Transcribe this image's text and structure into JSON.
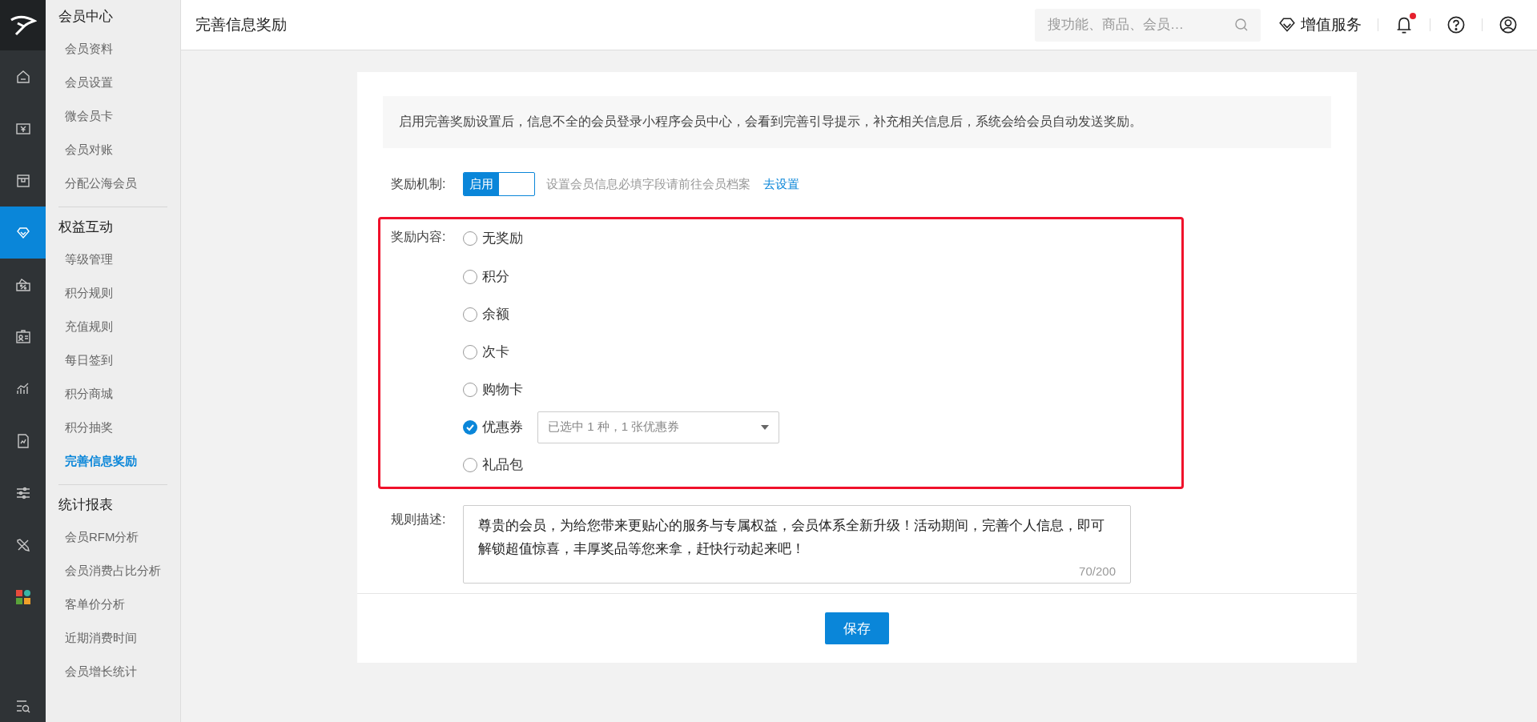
{
  "rail": {
    "items": [
      {
        "selected": false
      },
      {
        "selected": false
      },
      {
        "selected": false
      },
      {
        "selected": true
      },
      {
        "selected": false
      },
      {
        "selected": false
      },
      {
        "selected": false
      },
      {
        "selected": false
      },
      {
        "selected": false
      },
      {
        "selected": false
      },
      {
        "selected": false
      }
    ]
  },
  "sidebar": {
    "groups": [
      {
        "title": "会员中心",
        "items": [
          {
            "label": "会员资料",
            "selected": false
          },
          {
            "label": "会员设置",
            "selected": false
          },
          {
            "label": "微会员卡",
            "selected": false
          },
          {
            "label": "会员对账",
            "selected": false
          },
          {
            "label": "分配公海会员",
            "selected": false
          }
        ]
      },
      {
        "title": "权益互动",
        "items": [
          {
            "label": "等级管理",
            "selected": false
          },
          {
            "label": "积分规则",
            "selected": false
          },
          {
            "label": "充值规则",
            "selected": false
          },
          {
            "label": "每日签到",
            "selected": false
          },
          {
            "label": "积分商城",
            "selected": false
          },
          {
            "label": "积分抽奖",
            "selected": false
          },
          {
            "label": "完善信息奖励",
            "selected": true
          }
        ]
      },
      {
        "title": "统计报表",
        "items": [
          {
            "label": "会员RFM分析",
            "selected": false
          },
          {
            "label": "会员消费占比分析",
            "selected": false
          },
          {
            "label": "客单价分析",
            "selected": false
          },
          {
            "label": "近期消费时间",
            "selected": false
          },
          {
            "label": "会员增长统计",
            "selected": false
          }
        ]
      }
    ]
  },
  "header": {
    "title": "完善信息奖励",
    "search": {
      "placeholder": "搜功能、商品、会员…"
    },
    "value_service": "增值服务",
    "notification_unread": true
  },
  "notice": "启用完善奖励设置后，信息不全的会员登录小程序会员中心，会看到完善引导提示，补充相关信息后，系统会给会员自动发送奖励。",
  "mechanism": {
    "label": "奖励机制:",
    "toggle": {
      "label": "启用",
      "on": true
    },
    "hint": "设置会员信息必填字段请前往会员档案",
    "link": "去设置"
  },
  "reward": {
    "label": "奖励内容:",
    "options": [
      {
        "label": "无奖励",
        "selected": false
      },
      {
        "label": "积分",
        "selected": false
      },
      {
        "label": "余额",
        "selected": false
      },
      {
        "label": "次卡",
        "selected": false
      },
      {
        "label": "购物卡",
        "selected": false
      },
      {
        "label": "优惠券",
        "selected": true,
        "dropdown": "已选中 1 种，1 张优惠券"
      },
      {
        "label": "礼品包",
        "selected": false
      }
    ]
  },
  "description": {
    "label": "规则描述:",
    "value": "尊贵的会员，为给您带来更贴心的服务与专属权益，会员体系全新升级！活动期间，完善个人信息，即可解锁超值惊喜，丰厚奖品等您来拿，赶快行动起来吧！",
    "counter": "70/200"
  },
  "save_button": "保存"
}
